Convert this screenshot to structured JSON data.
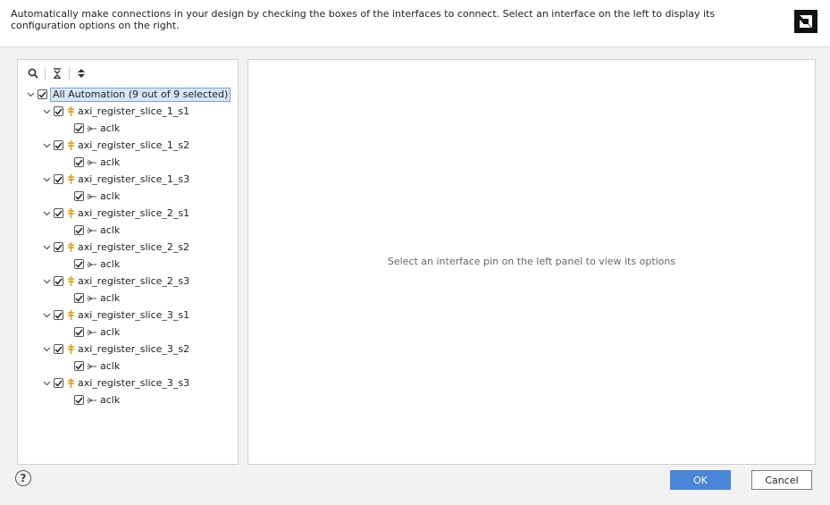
{
  "header": {
    "description": "Automatically make connections in your design by checking the boxes of the interfaces to connect. Select an interface on the left to display its configuration options on the right."
  },
  "toolbar": {
    "search_icon": "search-icon",
    "collapse_icon": "collapse-all-icon",
    "expand_icon": "expand-all-icon"
  },
  "tree": {
    "root_label": "All Automation (9 out of 9 selected)",
    "root_checked": true,
    "interfaces": [
      {
        "label": "axi_register_slice_1_s1",
        "checked": true,
        "pin": "aclk"
      },
      {
        "label": "axi_register_slice_1_s2",
        "checked": true,
        "pin": "aclk"
      },
      {
        "label": "axi_register_slice_1_s3",
        "checked": true,
        "pin": "aclk"
      },
      {
        "label": "axi_register_slice_2_s1",
        "checked": true,
        "pin": "aclk"
      },
      {
        "label": "axi_register_slice_2_s2",
        "checked": true,
        "pin": "aclk"
      },
      {
        "label": "axi_register_slice_2_s3",
        "checked": true,
        "pin": "aclk"
      },
      {
        "label": "axi_register_slice_3_s1",
        "checked": true,
        "pin": "aclk"
      },
      {
        "label": "axi_register_slice_3_s2",
        "checked": true,
        "pin": "aclk"
      },
      {
        "label": "axi_register_slice_3_s3",
        "checked": true,
        "pin": "aclk"
      }
    ]
  },
  "right_panel": {
    "placeholder": "Select an interface pin on the left panel to view its options"
  },
  "footer": {
    "help_label": "?",
    "ok_label": "OK",
    "cancel_label": "Cancel"
  },
  "colors": {
    "ok_button": "#4a86d8",
    "selection": "#d7e6f7",
    "interface_icon": "#e0a020"
  }
}
